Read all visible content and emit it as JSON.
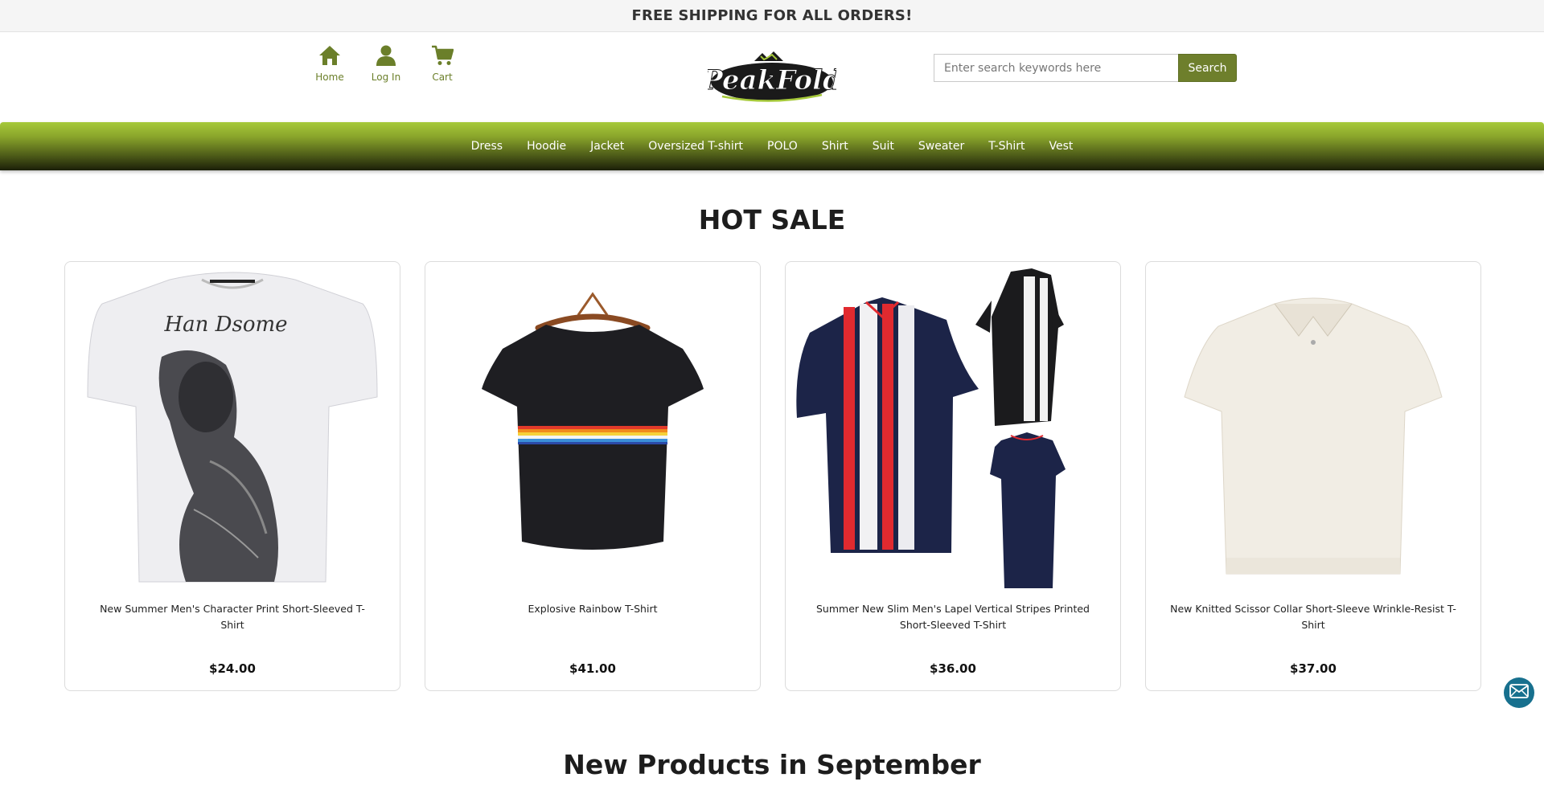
{
  "announcement": "FREE SHIPPING FOR ALL ORDERS!",
  "header": {
    "nav": [
      {
        "label": "Home",
        "icon": "home-icon"
      },
      {
        "label": "Log In",
        "icon": "user-icon"
      },
      {
        "label": "Cart",
        "icon": "cart-icon"
      }
    ],
    "logo_text": "PeakFold",
    "search": {
      "placeholder": "Enter search keywords here",
      "value": "",
      "button_label": "Search"
    }
  },
  "categories": [
    "Dress",
    "Hoodie",
    "Jacket",
    "Oversized T-shirt",
    "POLO",
    "Shirt",
    "Suit",
    "Sweater",
    "T-Shirt",
    "Vest"
  ],
  "hot_sale": {
    "title": "HOT SALE",
    "products": [
      {
        "name": "New Summer Men's Character Print Short-Sleeved T-Shirt",
        "price": "$24.00",
        "image_text": "Han Dsome"
      },
      {
        "name": "Explosive Rainbow T-Shirt",
        "price": "$41.00"
      },
      {
        "name": "Summer New Slim Men's Lapel Vertical Stripes Printed Short-Sleeved T-Shirt",
        "price": "$36.00"
      },
      {
        "name": "New Knitted Scissor Collar Short-Sleeve Wrinkle-Resist T-Shirt",
        "price": "$37.00"
      }
    ]
  },
  "new_products": {
    "title": "New Products in September"
  },
  "floating": {
    "icon": "mail-icon"
  },
  "colors": {
    "accent": "#6e7f2c",
    "nav_green": "#a6c93a",
    "mail_button": "#17708e"
  }
}
